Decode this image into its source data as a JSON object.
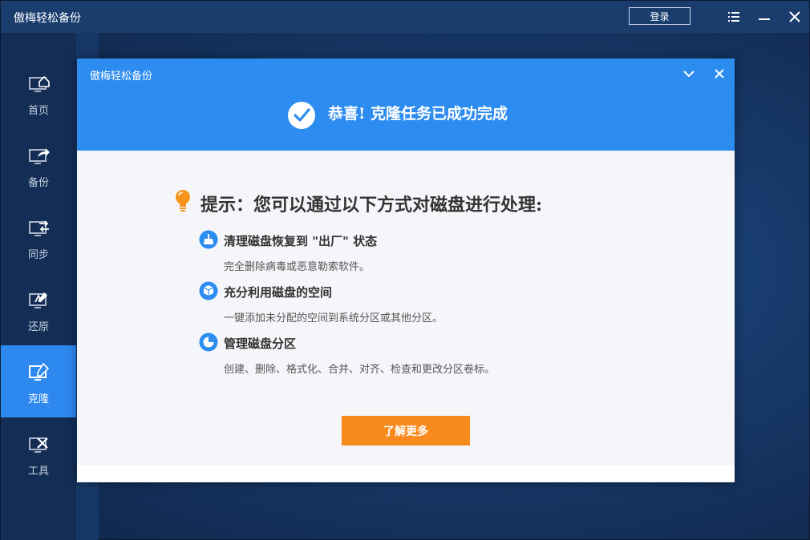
{
  "app": {
    "title": "傲梅轻松备份"
  },
  "titlebar": {
    "login_label": "登录",
    "menu_icon": "list-menu-icon",
    "minimize_icon": "minimize-icon",
    "close_icon": "close-icon"
  },
  "sidebar": {
    "items": [
      {
        "label": "首页",
        "icon": "home-monitor-icon",
        "active": false
      },
      {
        "label": "备份",
        "icon": "backup-monitor-icon",
        "active": false
      },
      {
        "label": "同步",
        "icon": "sync-monitor-icon",
        "active": false
      },
      {
        "label": "还原",
        "icon": "restore-monitor-icon",
        "active": false
      },
      {
        "label": "克隆",
        "icon": "clone-monitor-icon",
        "active": true
      },
      {
        "label": "工具",
        "icon": "tools-monitor-icon",
        "active": false
      }
    ]
  },
  "dialog": {
    "title": "傲梅轻松备份",
    "success_message": "恭喜! 克隆任务已成功完成",
    "tip_heading": "提示：您可以通过以下方式对磁盘进行处理:",
    "features": [
      {
        "icon": "broom-icon",
        "title": "清理磁盘恢复到 \"出厂\" 状态",
        "desc": "完全删除病毒或恶意勒索软件。"
      },
      {
        "icon": "cube-icon",
        "title": "充分利用磁盘的空间",
        "desc": "一键添加未分配的空间到系统分区或其他分区。"
      },
      {
        "icon": "pie-chart-icon",
        "title": "管理磁盘分区",
        "desc": "创建、删除、格式化、合并、对齐、检查和更改分区卷标。"
      }
    ],
    "learn_more_label": "了解更多"
  },
  "colors": {
    "accent": "#2d8cf0",
    "orange": "#f88a1e",
    "sidebar_bg": "#132d55"
  }
}
